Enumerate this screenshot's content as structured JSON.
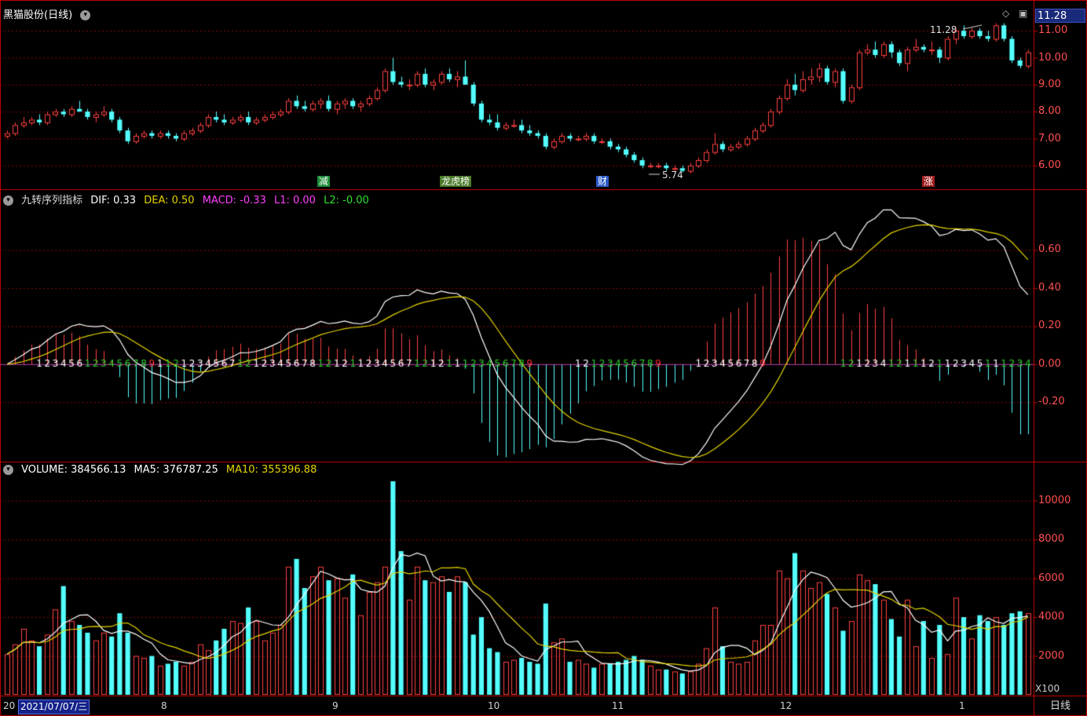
{
  "header": {
    "stock_title": "黑猫股份(日线)",
    "current_price": "11.28"
  },
  "price_axis": [
    "11.00",
    "10.00",
    "9.00",
    "8.00",
    "7.00",
    "6.00"
  ],
  "price_annotations": {
    "high": "11.28",
    "low": "5.74"
  },
  "event_tags": [
    {
      "label": "减",
      "color": "#1e8c3a"
    },
    {
      "label": "龙虎榜",
      "color": "#4a7a2a"
    },
    {
      "label": "财",
      "color": "#2a5ac8"
    },
    {
      "label": "涨",
      "color": "#a02020"
    }
  ],
  "macd_panel": {
    "name": "九转序列指标",
    "dif_label": "DIF: 0.33",
    "dea_label": "DEA: 0.50",
    "macd_label": "MACD: -0.33",
    "l1_label": "L1: 0.00",
    "l2_label": "L2: -0.00",
    "axis": [
      "0.60",
      "0.40",
      "0.20",
      "0.00",
      "-0.20"
    ]
  },
  "volume_panel": {
    "volume_label": "VOLUME: 384566.13",
    "ma5_label": "MA5: 376787.25",
    "ma10_label": "MA10: 355396.88",
    "axis": [
      "10000",
      "8000",
      "6000",
      "4000",
      "2000"
    ],
    "unit": "X100"
  },
  "x_axis": {
    "cursor_date": "2021/07/07/三",
    "months": [
      "8",
      "9",
      "10",
      "11",
      "12",
      "1"
    ],
    "left_label": "20"
  },
  "period_button": "日线",
  "colors": {
    "up": "#ff4040",
    "down": "#54ffff",
    "dif": "#ffffff",
    "dea": "#e6d400",
    "grid": "#8a0a0a",
    "border": "#c80000"
  },
  "chart_data": {
    "type": "candlestick",
    "n": 108,
    "ohlc": [
      [
        7.1,
        7.3,
        7.0,
        7.2
      ],
      [
        7.2,
        7.6,
        7.1,
        7.5
      ],
      [
        7.5,
        7.8,
        7.4,
        7.6
      ],
      [
        7.6,
        7.8,
        7.5,
        7.7
      ],
      [
        7.7,
        7.9,
        7.5,
        7.6
      ],
      [
        7.6,
        8.0,
        7.5,
        7.9
      ],
      [
        7.9,
        8.1,
        7.8,
        8.0
      ],
      [
        8.0,
        8.1,
        7.8,
        7.9
      ],
      [
        7.9,
        8.2,
        7.8,
        8.1
      ],
      [
        8.1,
        8.4,
        8.0,
        8.0
      ],
      [
        8.0,
        8.1,
        7.7,
        7.8
      ],
      [
        7.8,
        8.0,
        7.6,
        7.9
      ],
      [
        7.9,
        8.2,
        7.8,
        8.0
      ],
      [
        8.0,
        8.1,
        7.6,
        7.7
      ],
      [
        7.7,
        7.8,
        7.2,
        7.3
      ],
      [
        7.3,
        7.4,
        6.8,
        6.9
      ],
      [
        6.9,
        7.2,
        6.8,
        7.1
      ],
      [
        7.1,
        7.3,
        7.0,
        7.2
      ],
      [
        7.2,
        7.3,
        7.0,
        7.1
      ],
      [
        7.1,
        7.3,
        7.0,
        7.2
      ],
      [
        7.2,
        7.3,
        7.0,
        7.1
      ],
      [
        7.1,
        7.2,
        6.9,
        7.0
      ],
      [
        7.0,
        7.3,
        6.9,
        7.2
      ],
      [
        7.2,
        7.4,
        7.1,
        7.3
      ],
      [
        7.3,
        7.6,
        7.2,
        7.5
      ],
      [
        7.5,
        7.9,
        7.4,
        7.8
      ],
      [
        7.8,
        8.0,
        7.6,
        7.7
      ],
      [
        7.7,
        7.9,
        7.5,
        7.6
      ],
      [
        7.6,
        7.8,
        7.5,
        7.7
      ],
      [
        7.7,
        7.9,
        7.6,
        7.8
      ],
      [
        7.8,
        8.0,
        7.5,
        7.6
      ],
      [
        7.6,
        7.8,
        7.5,
        7.7
      ],
      [
        7.7,
        7.9,
        7.6,
        7.8
      ],
      [
        7.8,
        8.0,
        7.7,
        7.9
      ],
      [
        7.9,
        8.1,
        7.8,
        8.0
      ],
      [
        8.0,
        8.5,
        7.9,
        8.4
      ],
      [
        8.4,
        8.6,
        8.1,
        8.2
      ],
      [
        8.2,
        8.4,
        8.0,
        8.1
      ],
      [
        8.1,
        8.4,
        8.0,
        8.3
      ],
      [
        8.3,
        8.5,
        8.1,
        8.4
      ],
      [
        8.4,
        8.6,
        8.0,
        8.1
      ],
      [
        8.1,
        8.4,
        7.9,
        8.3
      ],
      [
        8.3,
        8.5,
        8.1,
        8.4
      ],
      [
        8.4,
        8.5,
        8.1,
        8.2
      ],
      [
        8.2,
        8.4,
        8.0,
        8.3
      ],
      [
        8.3,
        8.6,
        8.2,
        8.5
      ],
      [
        8.5,
        8.9,
        8.4,
        8.8
      ],
      [
        8.8,
        9.6,
        8.7,
        9.5
      ],
      [
        9.5,
        10.0,
        9.0,
        9.1
      ],
      [
        9.1,
        9.3,
        8.9,
        9.0
      ],
      [
        9.0,
        9.2,
        8.8,
        9.0
      ],
      [
        9.0,
        9.5,
        8.9,
        9.4
      ],
      [
        9.4,
        9.6,
        8.9,
        9.0
      ],
      [
        9.0,
        9.2,
        8.8,
        9.1
      ],
      [
        9.1,
        9.5,
        9.0,
        9.4
      ],
      [
        9.4,
        9.6,
        9.1,
        9.2
      ],
      [
        9.2,
        9.5,
        8.9,
        9.3
      ],
      [
        9.3,
        9.9,
        9.0,
        9.0
      ],
      [
        9.0,
        9.1,
        8.2,
        8.3
      ],
      [
        8.3,
        8.4,
        7.6,
        7.7
      ],
      [
        7.7,
        7.9,
        7.5,
        7.6
      ],
      [
        7.6,
        7.9,
        7.3,
        7.4
      ],
      [
        7.4,
        7.6,
        7.3,
        7.5
      ],
      [
        7.5,
        7.7,
        7.4,
        7.5
      ],
      [
        7.5,
        7.7,
        7.2,
        7.3
      ],
      [
        7.3,
        7.5,
        7.1,
        7.2
      ],
      [
        7.2,
        7.3,
        7.0,
        7.1
      ],
      [
        7.1,
        7.2,
        6.6,
        6.7
      ],
      [
        6.7,
        7.0,
        6.6,
        6.9
      ],
      [
        6.9,
        7.2,
        6.8,
        7.1
      ],
      [
        7.1,
        7.2,
        6.9,
        7.0
      ],
      [
        7.0,
        7.1,
        6.9,
        7.0
      ],
      [
        7.0,
        7.2,
        6.9,
        7.1
      ],
      [
        7.1,
        7.2,
        6.8,
        6.9
      ],
      [
        6.9,
        7.0,
        6.8,
        6.9
      ],
      [
        6.9,
        7.0,
        6.6,
        6.7
      ],
      [
        6.7,
        6.8,
        6.5,
        6.6
      ],
      [
        6.6,
        6.7,
        6.3,
        6.4
      ],
      [
        6.4,
        6.5,
        6.1,
        6.2
      ],
      [
        6.2,
        6.3,
        5.9,
        6.0
      ],
      [
        6.0,
        6.1,
        5.9,
        6.0
      ],
      [
        6.0,
        6.1,
        5.9,
        6.0
      ],
      [
        6.0,
        6.1,
        5.8,
        5.9
      ],
      [
        5.9,
        6.0,
        5.8,
        5.9
      ],
      [
        5.9,
        6.0,
        5.74,
        5.8
      ],
      [
        5.8,
        6.1,
        5.7,
        6.0
      ],
      [
        6.0,
        6.3,
        5.9,
        6.2
      ],
      [
        6.2,
        6.6,
        6.1,
        6.5
      ],
      [
        6.5,
        7.2,
        6.4,
        6.8
      ],
      [
        6.8,
        6.9,
        6.5,
        6.6
      ],
      [
        6.6,
        6.8,
        6.5,
        6.7
      ],
      [
        6.7,
        6.9,
        6.6,
        6.8
      ],
      [
        6.8,
        7.1,
        6.7,
        7.0
      ],
      [
        7.0,
        7.4,
        6.9,
        7.3
      ],
      [
        7.3,
        7.6,
        7.2,
        7.5
      ],
      [
        7.5,
        8.1,
        7.4,
        8.0
      ],
      [
        8.0,
        8.6,
        7.9,
        8.5
      ],
      [
        8.5,
        9.2,
        8.4,
        9.0
      ],
      [
        9.0,
        9.4,
        8.6,
        8.8
      ],
      [
        8.8,
        9.5,
        8.7,
        9.2
      ],
      [
        9.2,
        9.6,
        9.0,
        9.3
      ],
      [
        9.3,
        9.8,
        9.1,
        9.6
      ],
      [
        9.6,
        9.7,
        9.0,
        9.1
      ],
      [
        9.1,
        9.6,
        8.9,
        9.5
      ],
      [
        9.5,
        9.6,
        8.3,
        8.4
      ],
      [
        8.4,
        9.0,
        8.3,
        8.9
      ],
      [
        8.9,
        10.3,
        8.8,
        10.2
      ],
      [
        10.2,
        10.5,
        10.1,
        10.3
      ]
    ],
    "ohlc_tail": [
      [
        10.3,
        10.6,
        10.0,
        10.1
      ],
      [
        10.1,
        10.6,
        10.0,
        10.5
      ],
      [
        10.5,
        10.6,
        10.0,
        10.2
      ],
      [
        10.2,
        10.3,
        9.7,
        9.8
      ],
      [
        9.8,
        10.4,
        9.5,
        10.3
      ],
      [
        10.3,
        10.7,
        10.2,
        10.4
      ],
      [
        10.4,
        10.5,
        10.2,
        10.3
      ],
      [
        10.3,
        10.6,
        10.1,
        10.3
      ],
      [
        10.3,
        10.4,
        9.8,
        10.0
      ],
      [
        10.0,
        10.8,
        9.9,
        10.7
      ],
      [
        10.7,
        11.1,
        10.5,
        11.0
      ],
      [
        11.0,
        11.2,
        10.7,
        10.8
      ],
      [
        10.8,
        11.1,
        10.7,
        11.0
      ],
      [
        11.0,
        11.1,
        10.7,
        10.8
      ],
      [
        10.8,
        11.0,
        10.6,
        10.7
      ],
      [
        10.7,
        11.28,
        10.6,
        11.2
      ],
      [
        11.2,
        11.28,
        10.6,
        10.7
      ],
      [
        10.7,
        10.8,
        9.8,
        9.9
      ],
      [
        9.9,
        10.0,
        9.6,
        9.7
      ],
      [
        9.7,
        10.3,
        9.6,
        10.2
      ]
    ],
    "volume": [
      2100,
      2600,
      3400,
      2800,
      2500,
      3100,
      4400,
      5600,
      3800,
      3600,
      3200,
      2800,
      3200,
      3000,
      4200,
      3200,
      2000,
      1900,
      2000,
      1500,
      1600,
      1700,
      1500,
      1700,
      2600,
      2300,
      2800,
      3400,
      3800,
      3700,
      4500,
      3800,
      2800,
      3200,
      3600,
      6600,
      7000,
      5500,
      6100,
      6600,
      5900,
      6000,
      5000,
      6200,
      4100,
      5300,
      5800,
      6600,
      11000,
      7400,
      4900,
      6600,
      5900,
      5800,
      6100,
      5300,
      6100,
      5800,
      3100,
      4000,
      2400,
      2200,
      1700,
      1800,
      1900,
      1700,
      1600,
      4700,
      2700,
      2900,
      1700,
      1800,
      1600,
      1400,
      1600,
      1600,
      1700,
      1800,
      2000,
      1800,
      1500,
      1300,
      1300,
      1200,
      1100,
      1200,
      1600,
      2400,
      4500,
      2500,
      1700,
      1600,
      1700,
      2800,
      3600,
      3600,
      6400,
      6000,
      7300,
      6400,
      5500,
      5800,
      5200,
      4500,
      3300,
      3800,
      6200,
      5900
    ],
    "volume_tail": [
      5700,
      4900,
      3900,
      3000,
      4900,
      2500,
      3800,
      1900,
      3600,
      2100,
      5000,
      4000,
      2900,
      4100,
      3800,
      4000,
      3600,
      4200,
      4300,
      4200
    ],
    "macd_axis_range": [
      -0.5,
      0.8
    ],
    "price_axis_range": [
      5.5,
      11.5
    ],
    "volume_axis_range": [
      0,
      11000
    ]
  }
}
